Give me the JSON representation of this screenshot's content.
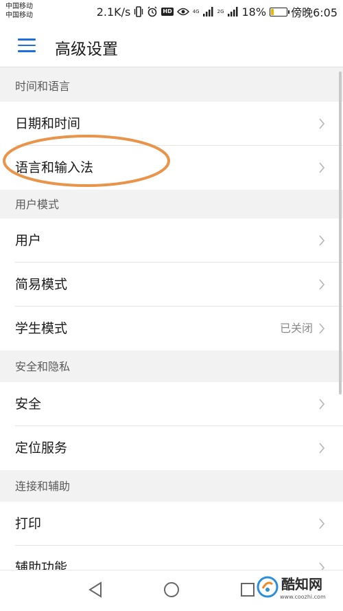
{
  "status_bar": {
    "carrier_1": "中国移动",
    "carrier_2": "中国移动",
    "net_speed": "2.1K/s",
    "hd_label": "HD",
    "sim1_network": "4G",
    "sim2_network": "2G",
    "battery": "18%",
    "battery_level": 0.18,
    "time": "傍晚6:05"
  },
  "header": {
    "title": "高级设置",
    "menu_icon": "menu-icon"
  },
  "sections": [
    {
      "title": "时间和语言",
      "items": [
        {
          "label": "日期和时间",
          "value": ""
        },
        {
          "label": "语言和输入法",
          "value": ""
        }
      ]
    },
    {
      "title": "用户模式",
      "items": [
        {
          "label": "用户",
          "value": ""
        },
        {
          "label": "简易模式",
          "value": ""
        },
        {
          "label": "学生模式",
          "value": "已关闭"
        }
      ]
    },
    {
      "title": "安全和隐私",
      "items": [
        {
          "label": "安全",
          "value": ""
        },
        {
          "label": "定位服务",
          "value": ""
        }
      ]
    },
    {
      "title": "连接和辅助",
      "items": [
        {
          "label": "打印",
          "value": ""
        },
        {
          "label": "辅助功能",
          "value": ""
        }
      ]
    }
  ],
  "watermark": {
    "name": "酷知网",
    "url": "www.coozhi.com"
  },
  "colors": {
    "accent": "#1e6fd9",
    "annotation": "#e8944a",
    "battery": "#f0b400"
  }
}
